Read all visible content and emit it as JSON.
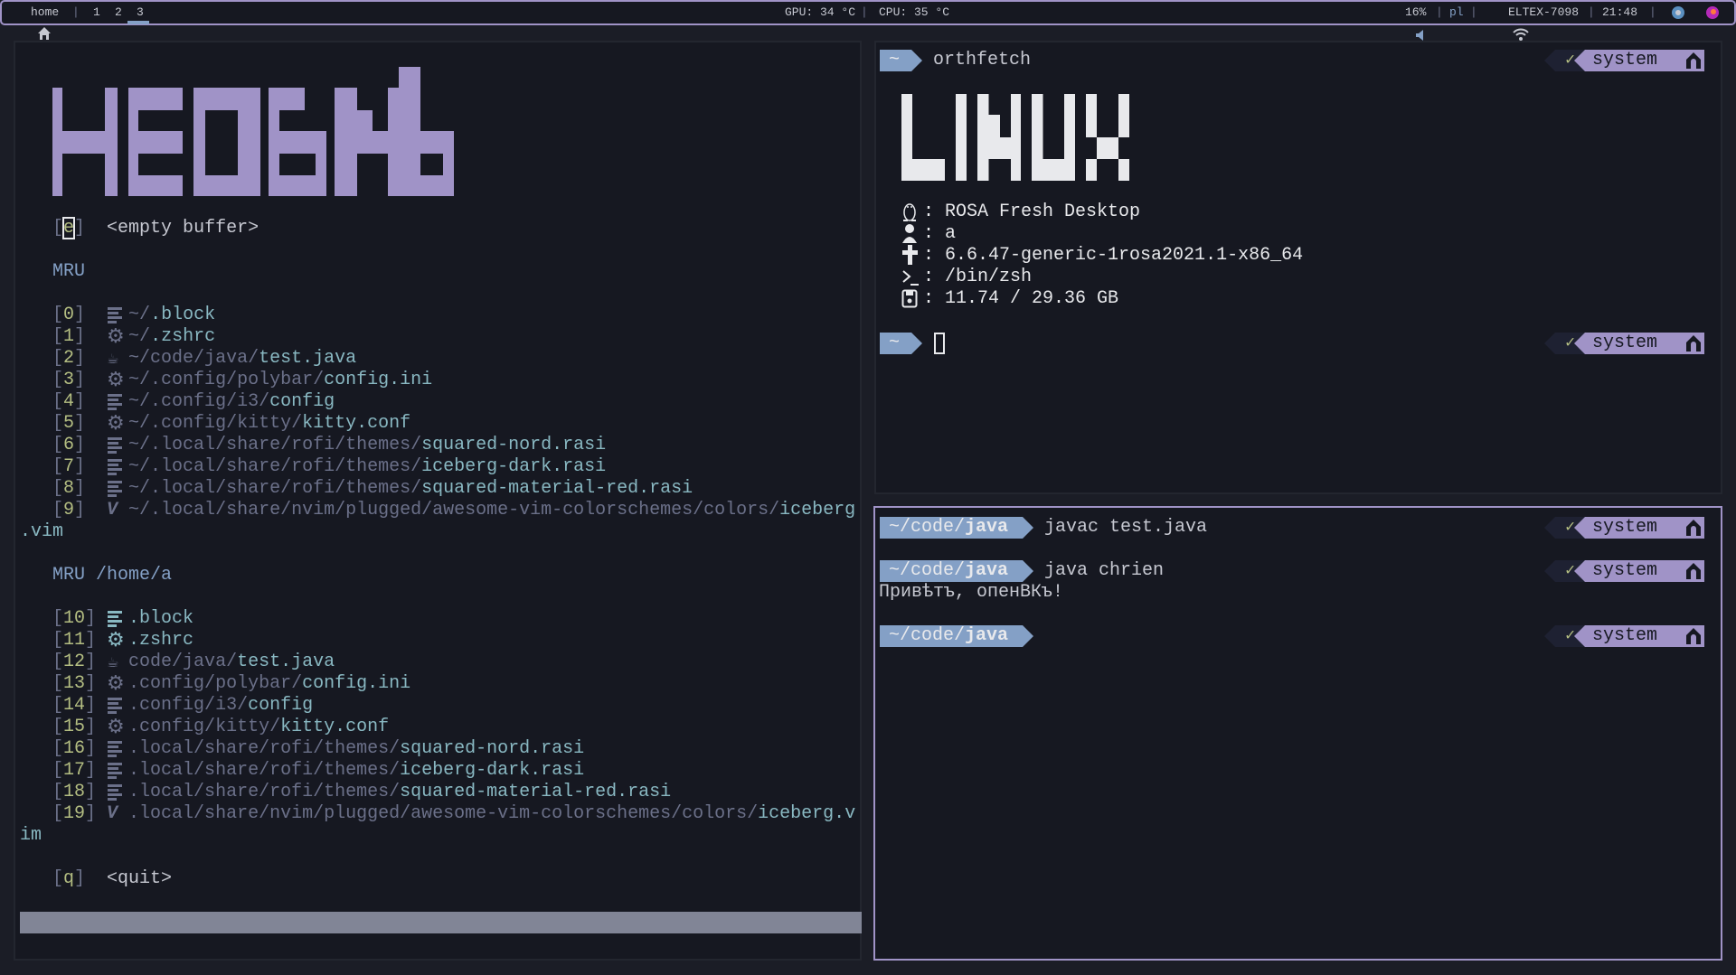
{
  "topbar": {
    "home_label": "home",
    "workspaces": [
      "1",
      "2",
      "3"
    ],
    "active_workspace": "3",
    "gpu": "GPU: 34 °C",
    "cpu": "CPU: 35 °C",
    "volume": "16%",
    "keyboard_layout": "pl",
    "wifi": "ELTEX-7098",
    "time": "21:48",
    "separator": "|",
    "colors": {
      "accent": "#a093c7",
      "bg": "#161821"
    }
  },
  "nvim": {
    "logo_text": "HEOBIMb",
    "empty_key": "e",
    "empty_label": "<empty buffer>",
    "mru_heading": "MRU",
    "mru": [
      {
        "key": "0",
        "icon": "lines",
        "dir": "~/",
        "file": ".block"
      },
      {
        "key": "1",
        "icon": "gear",
        "dir": "~/",
        "file": ".zshrc"
      },
      {
        "key": "2",
        "icon": "java",
        "dir": "~/code/java/",
        "file": "test.java"
      },
      {
        "key": "3",
        "icon": "gear",
        "dir": "~/.config/polybar/",
        "file": "config.ini"
      },
      {
        "key": "4",
        "icon": "lines",
        "dir": "~/.config/i3/",
        "file": "config"
      },
      {
        "key": "5",
        "icon": "gear",
        "dir": "~/.config/kitty/",
        "file": "kitty.conf"
      },
      {
        "key": "6",
        "icon": "lines",
        "dir": "~/.local/share/rofi/themes/",
        "file": "squared-nord.rasi"
      },
      {
        "key": "7",
        "icon": "lines",
        "dir": "~/.local/share/rofi/themes/",
        "file": "iceberg-dark.rasi"
      },
      {
        "key": "8",
        "icon": "lines",
        "dir": "~/.local/share/rofi/themes/",
        "file": "squared-material-red.rasi"
      },
      {
        "key": "9",
        "icon": "vim",
        "dir": "~/.local/share/nvim/plugged/awesome-vim-colorschemes/colors/",
        "file": "iceberg",
        "wrap": ".vim"
      }
    ],
    "mru_cwd_heading": "MRU /home/a",
    "mru_cwd": [
      {
        "key": "10",
        "icon": "lines",
        "dir": "",
        "file": ".block",
        "teal_icon": true
      },
      {
        "key": "11",
        "icon": "gear",
        "dir": "",
        "file": ".zshrc",
        "teal_icon": true
      },
      {
        "key": "12",
        "icon": "java",
        "dir": "code/java/",
        "file": "test.java"
      },
      {
        "key": "13",
        "icon": "gear",
        "dir": ".config/polybar/",
        "file": "config.ini"
      },
      {
        "key": "14",
        "icon": "lines",
        "dir": ".config/i3/",
        "file": "config"
      },
      {
        "key": "15",
        "icon": "gear",
        "dir": ".config/kitty/",
        "file": "kitty.conf"
      },
      {
        "key": "16",
        "icon": "lines",
        "dir": ".local/share/rofi/themes/",
        "file": "squared-nord.rasi"
      },
      {
        "key": "17",
        "icon": "lines",
        "dir": ".local/share/rofi/themes/",
        "file": "iceberg-dark.rasi"
      },
      {
        "key": "18",
        "icon": "lines",
        "dir": ".local/share/rofi/themes/",
        "file": "squared-material-red.rasi"
      },
      {
        "key": "19",
        "icon": "vim",
        "dir": ".local/share/nvim/plugged/awesome-vim-colorschemes/colors/",
        "file": "iceberg.v",
        "wrap": "im"
      }
    ],
    "quit_key": "q",
    "quit_label": "<quit>"
  },
  "fetch_terminal": {
    "prompt_dir": "~",
    "command": "orthfetch",
    "logo_text": "LINUX",
    "info": [
      {
        "icon": "tux",
        "value": "ROSA Fresh Desktop"
      },
      {
        "icon": "user",
        "value": "a"
      },
      {
        "icon": "kernel",
        "value": "6.6.47-generic-1rosa2021.1-x86_64"
      },
      {
        "icon": "shell",
        "value": "/bin/zsh"
      },
      {
        "icon": "disk",
        "value": "11.74 / 29.36 GB"
      }
    ],
    "status_check": "✓",
    "env_label": "system"
  },
  "java_terminal": {
    "prompt_dir_prefix": "~/code/",
    "prompt_dir_last": "java",
    "commands": [
      "javac test.java",
      "java chrien",
      ""
    ],
    "output": "Привѣтъ, опенВКъ!",
    "status_check": "✓",
    "env_label": "system"
  }
}
